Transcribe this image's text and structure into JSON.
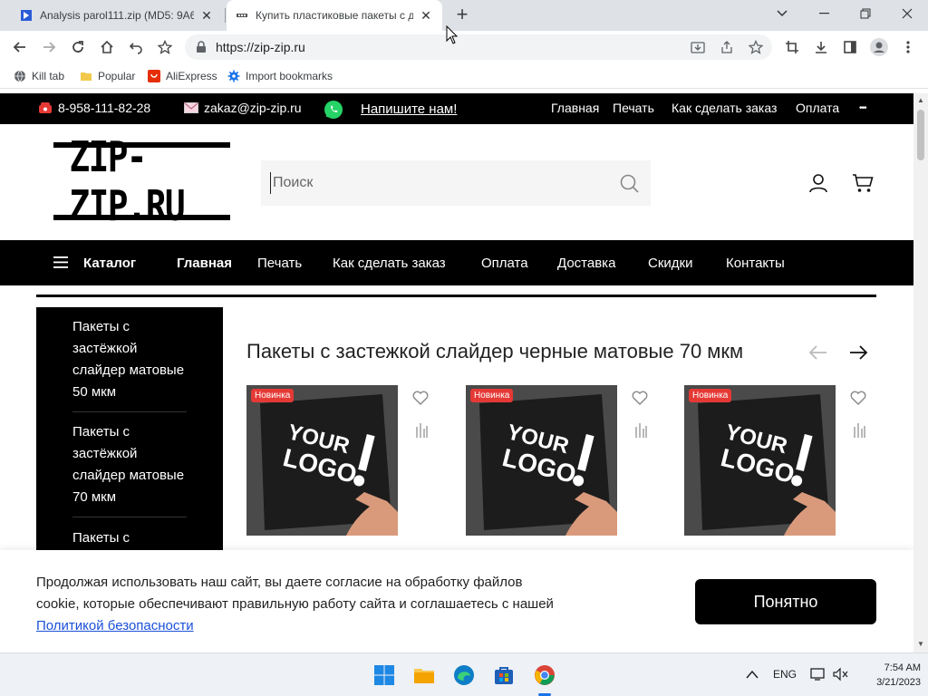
{
  "browser": {
    "tabs": [
      {
        "title": "Analysis parol111.zip (MD5: 9A6C",
        "active": false
      },
      {
        "title": "Купить пластиковые пакеты с д",
        "active": true
      }
    ],
    "url": "https://zip-zip.ru",
    "bookmarks": [
      "Kill tab",
      "Popular",
      "AliExpress",
      "Import bookmarks"
    ]
  },
  "topstrip": {
    "phone": "8-958-111-82-28",
    "email": "zakaz@zip-zip.ru",
    "write_us": "Напишите нам!",
    "links": [
      "Главная",
      "Печать",
      "Как сделать заказ",
      "Оплата"
    ],
    "more": "•••"
  },
  "header": {
    "logo": "ZIP-ZIP.RU",
    "search_placeholder": "Поиск"
  },
  "nav": {
    "catalog": "Каталог",
    "items": [
      "Главная",
      "Печать",
      "Как сделать заказ",
      "Оплата",
      "Доставка",
      "Скидки",
      "Контакты"
    ]
  },
  "sidebar": {
    "items": [
      "Пакеты с застёжкой слайдер матовые 50 мкм",
      "Пакеты с застёжкой слайдер матовые 70 мкм",
      "Пакеты с"
    ]
  },
  "section": {
    "title": "Пакеты с застежкой слайдер черные матовые 70 мкм",
    "cards": [
      {
        "badge": "Новинка",
        "logo_line1": "YOUR",
        "logo_line2": "LOGO"
      },
      {
        "badge": "Новинка",
        "logo_line1": "YOUR",
        "logo_line2": "LOGO"
      },
      {
        "badge": "Новинка",
        "logo_line1": "YOUR",
        "logo_line2": "LOGO"
      }
    ]
  },
  "cookie": {
    "text": "Продолжая использовать наш сайт, вы даете согласие на обработку файлов cookie, которые обеспечивают правильную работу сайта и соглашаетесь с нашей ",
    "link": "Политикой безопасности",
    "button": "Понятно"
  },
  "taskbar": {
    "lang": "ENG",
    "time": "7:54 AM",
    "date": "3/21/2023"
  },
  "colors": {
    "accent_red": "#e53935",
    "link_blue": "#1a4fd8",
    "whatsapp_green": "#25d366"
  }
}
